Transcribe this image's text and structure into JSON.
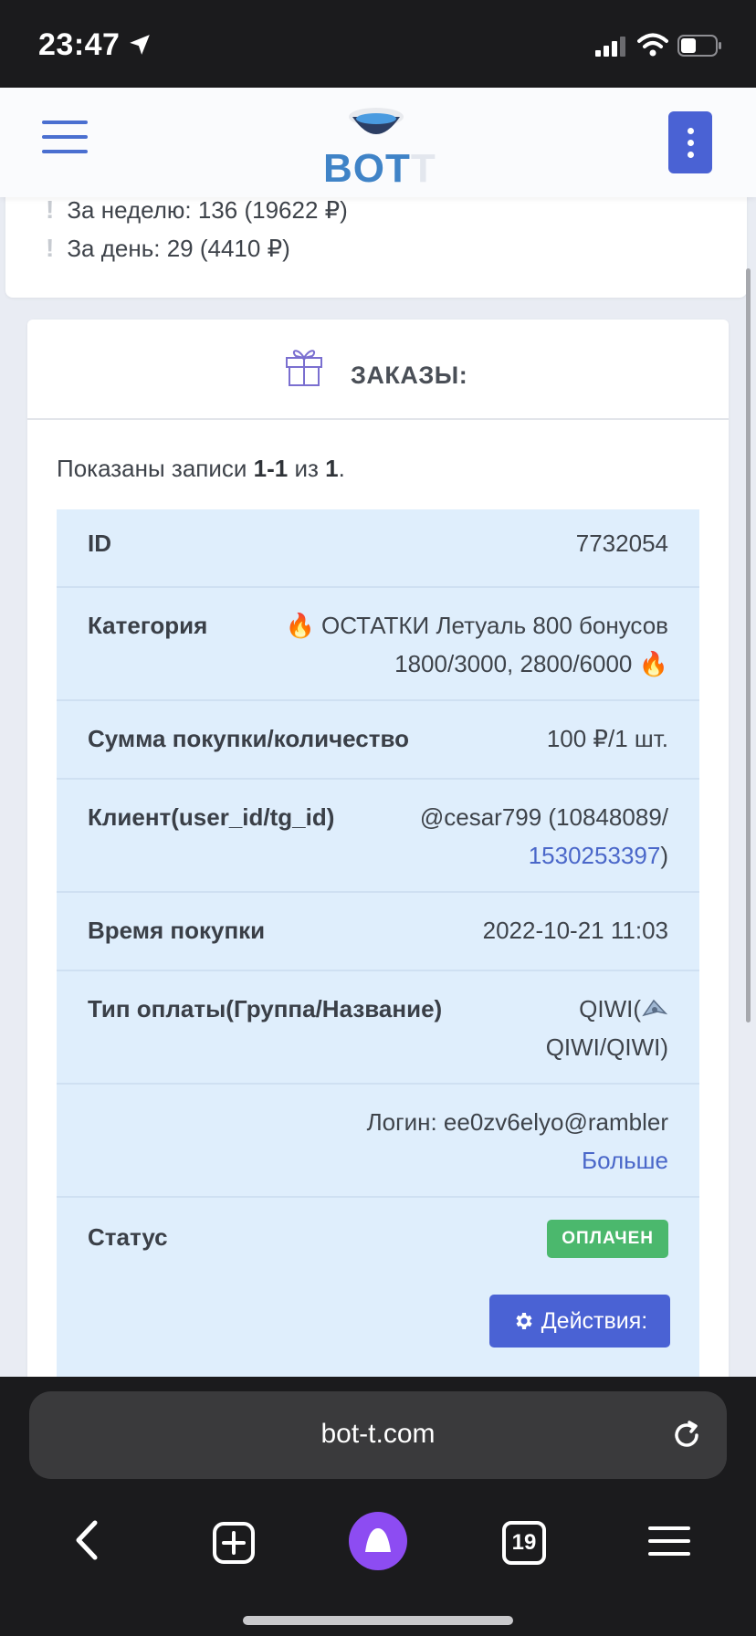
{
  "status_bar": {
    "time": "23:47"
  },
  "header": {
    "logo_text_main": "BOT",
    "logo_text_faint": "T"
  },
  "stats": {
    "week": "За неделю: 136 (19622 ₽)",
    "day": "За день: 29 (4410 ₽)",
    "marker": "!"
  },
  "orders": {
    "title": "ЗАКАЗЫ:",
    "summary_prefix": "Показаны записи ",
    "summary_range": "1-1",
    "summary_mid": " из ",
    "summary_total": "1",
    "summary_end": ".",
    "rows": {
      "id": {
        "label": "ID",
        "value": "7732054"
      },
      "category": {
        "label": "Категория",
        "value_line1": "🔥 ОСТАТКИ Летуаль 800 бонусов",
        "value_line2": "1800/3000, 2800/6000 🔥"
      },
      "sum": {
        "label": "Сумма покупки/количество",
        "value": "100 ₽/1 шт."
      },
      "client": {
        "label": "Клиент(user_id/tg_id)",
        "value_line1": "@cesar799 (10848089/",
        "value_link": "1530253397",
        "value_close": ")"
      },
      "time": {
        "label": "Время покупки",
        "value": "2022-10-21 11:03"
      },
      "payment": {
        "label": "Тип оплаты(Группа/Название)",
        "value_line1": "QIWI(",
        "value_line2": "QIWI/QIWI)"
      },
      "login": {
        "value": "Логин: ee0zv6elyo@rambler",
        "more": "Больше"
      },
      "status": {
        "label": "Статус",
        "badge": "ОПЛАЧЕН",
        "action": "Действия:"
      }
    }
  },
  "browser": {
    "url": "bot-t.com",
    "tabs_count": "19"
  },
  "colors": {
    "accent": "#4a62d4",
    "success": "#4bb86d",
    "table_bg": "#dfeefc",
    "link": "#4a67c9"
  }
}
